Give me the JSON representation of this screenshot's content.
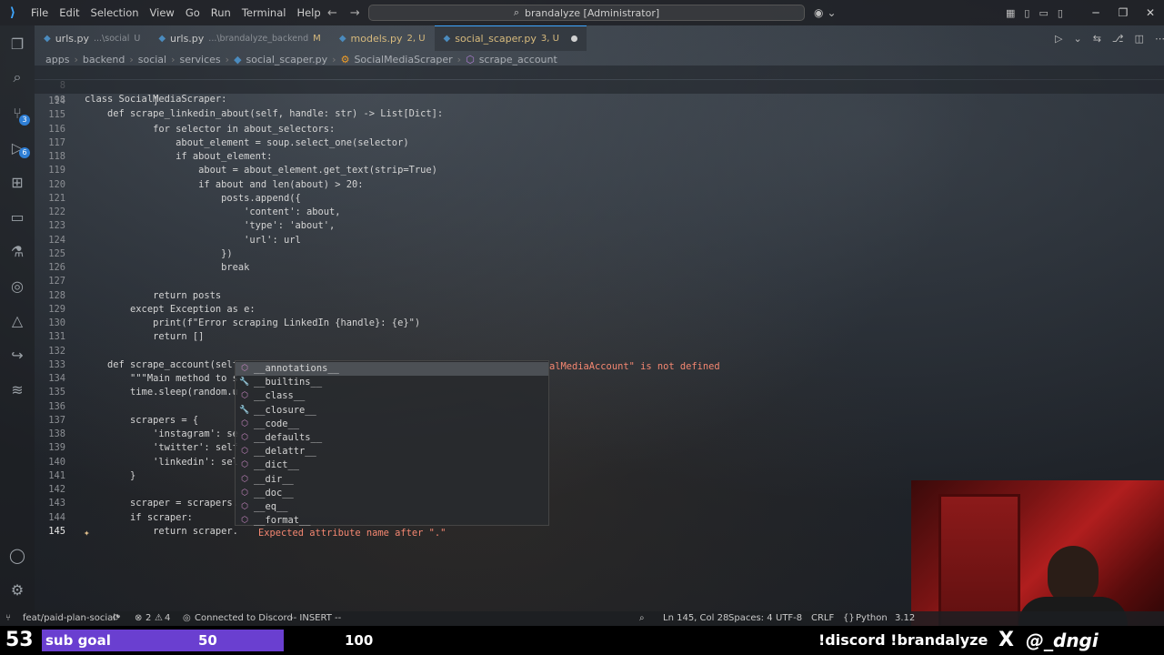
{
  "menu": [
    "File",
    "Edit",
    "Selection",
    "View",
    "Go",
    "Run",
    "Terminal",
    "Help"
  ],
  "command_center": "brandalyze [Administrator]",
  "tabs": [
    {
      "name": "urls.py",
      "path": "...\\social",
      "status": "U"
    },
    {
      "name": "urls.py",
      "path": "...\\brandalyze_backend",
      "status": "M"
    },
    {
      "name": "models.py",
      "path": "",
      "status": "2, U"
    },
    {
      "name": "social_scaper.py",
      "path": "",
      "status": "3, U"
    }
  ],
  "breadcrumb": [
    "apps",
    "backend",
    "social",
    "services",
    "social_scaper.py",
    "SocialMediaScraper",
    "scrape_account"
  ],
  "activity_badges": {
    "source_control": "3",
    "extensions": "6"
  },
  "sticky_lines": [
    {
      "n": "8",
      "code": "class SocialMediaScraper:"
    },
    {
      "n": "98",
      "code": "    def scrape_linkedin_about(self, handle: str) -> List[Dict]:"
    }
  ],
  "code_lines": [
    {
      "n": "114",
      "code": "            ]"
    },
    {
      "n": "115",
      "code": ""
    },
    {
      "n": "116",
      "code": "            for selector in about_selectors:"
    },
    {
      "n": "117",
      "code": "                about_element = soup.select_one(selector)"
    },
    {
      "n": "118",
      "code": "                if about_element:"
    },
    {
      "n": "119",
      "code": "                    about = about_element.get_text(strip=True)"
    },
    {
      "n": "120",
      "code": "                    if about and len(about) > 20:"
    },
    {
      "n": "121",
      "code": "                        posts.append({"
    },
    {
      "n": "122",
      "code": "                            'content': about,"
    },
    {
      "n": "123",
      "code": "                            'type': 'about',"
    },
    {
      "n": "124",
      "code": "                            'url': url"
    },
    {
      "n": "125",
      "code": "                        })"
    },
    {
      "n": "126",
      "code": "                        break"
    },
    {
      "n": "127",
      "code": ""
    },
    {
      "n": "128",
      "code": "            return posts"
    },
    {
      "n": "129",
      "code": "        except Exception as e:"
    },
    {
      "n": "130",
      "code": "            print(f\"Error scraping LinkedIn {handle}: {e}\")"
    },
    {
      "n": "131",
      "code": "            return []"
    },
    {
      "n": "132",
      "code": ""
    },
    {
      "n": "133",
      "code": "    def scrape_account(self"
    },
    {
      "n": "134",
      "code": "        \"\"\"Main method to s"
    },
    {
      "n": "135",
      "code": "        time.sleep(random.u"
    },
    {
      "n": "136",
      "code": ""
    },
    {
      "n": "137",
      "code": "        scrapers = {"
    },
    {
      "n": "138",
      "code": "            'instagram': se"
    },
    {
      "n": "139",
      "code": "            'twitter': self"
    },
    {
      "n": "140",
      "code": "            'linkedin': sel"
    },
    {
      "n": "141",
      "code": "        }"
    },
    {
      "n": "142",
      "code": ""
    },
    {
      "n": "143",
      "code": "        scraper = scrapers."
    },
    {
      "n": "144",
      "code": "        if scraper:"
    },
    {
      "n": "145",
      "code": "            return scraper."
    }
  ],
  "line133_error": "alMediaAccount\" is not defined",
  "line145_hint": "Expected attribute name after \".\"",
  "suggestions": [
    "__annotations__",
    "__builtins__",
    "__class__",
    "__closure__",
    "__code__",
    "__defaults__",
    "__delattr__",
    "__dict__",
    "__dir__",
    "__doc__",
    "__eq__",
    "__format__"
  ],
  "status": {
    "branch": "feat/paid-plan-social*",
    "errors": "2",
    "warnings": "4",
    "discord": "Connected to Discord",
    "mode": "-- INSERT --",
    "position": "Ln 145, Col 28",
    "spaces": "Spaces: 4",
    "encoding": "UTF-8",
    "eol": "CRLF",
    "language": "Python",
    "version": "3.12"
  },
  "overlay": {
    "sub_count": "53",
    "sub_label": "sub goal",
    "sub_current": "50",
    "sub_target": "100",
    "sub_progress": 0.8,
    "discord_cmd": "!discord !brandalyze",
    "x_logo": "X",
    "handle": "@_dngi"
  },
  "colors": {
    "accent": "#3ea6ff",
    "sub_bar": "#6a3fd0",
    "error": "#f48771",
    "keyword": "#c586c0"
  }
}
